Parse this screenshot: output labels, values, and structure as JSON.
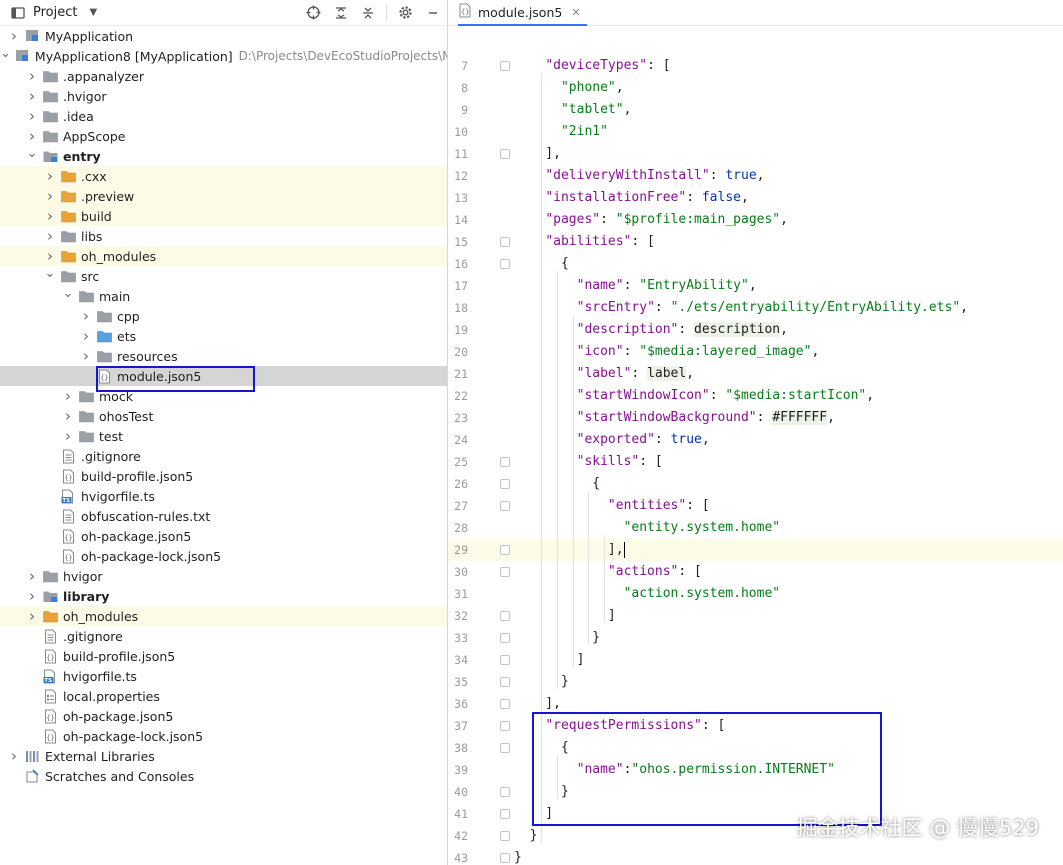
{
  "project_panel": {
    "title": "Project",
    "tree": [
      {
        "label": "MyApplication",
        "icon": "module-icon",
        "chev": "right",
        "indent": 0
      },
      {
        "label": "MyApplication8 [MyApplication]",
        "path": "D:\\Projects\\DevEcoStudioProjects\\M",
        "icon": "module-icon",
        "chev": "down",
        "indent": 0
      },
      {
        "label": ".appanalyzer",
        "icon": "folder-icon",
        "chev": "right",
        "indent": 1
      },
      {
        "label": ".hvigor",
        "icon": "folder-icon",
        "chev": "right",
        "indent": 1
      },
      {
        "label": ".idea",
        "icon": "folder-icon",
        "chev": "right",
        "indent": 1
      },
      {
        "label": "AppScope",
        "icon": "folder-icon",
        "chev": "right",
        "indent": 1
      },
      {
        "label": "entry",
        "icon": "module-folder-icon",
        "chev": "down",
        "indent": 1,
        "bold": true
      },
      {
        "label": ".cxx",
        "icon": "orange-folder-icon",
        "chev": "right",
        "indent": 2,
        "hl": true
      },
      {
        "label": ".preview",
        "icon": "orange-folder-icon",
        "chev": "right",
        "indent": 2,
        "hl": true
      },
      {
        "label": "build",
        "icon": "orange-folder-icon",
        "chev": "right",
        "indent": 2,
        "hl": true
      },
      {
        "label": "libs",
        "icon": "folder-icon",
        "chev": "right",
        "indent": 2
      },
      {
        "label": "oh_modules",
        "icon": "orange-folder-icon",
        "chev": "right",
        "indent": 2,
        "hl": true
      },
      {
        "label": "src",
        "icon": "folder-icon",
        "chev": "down",
        "indent": 2
      },
      {
        "label": "main",
        "icon": "folder-icon",
        "chev": "down",
        "indent": 3
      },
      {
        "label": "cpp",
        "icon": "folder-icon",
        "chev": "right",
        "indent": 4
      },
      {
        "label": "ets",
        "icon": "blue-folder-icon",
        "chev": "right",
        "indent": 4
      },
      {
        "label": "resources",
        "icon": "folder-icon",
        "chev": "right",
        "indent": 4
      },
      {
        "label": "module.json5",
        "icon": "json-file-icon",
        "chev": "none",
        "indent": 4,
        "sel": true
      },
      {
        "label": "mock",
        "icon": "folder-icon",
        "chev": "right",
        "indent": 3
      },
      {
        "label": "ohosTest",
        "icon": "folder-icon",
        "chev": "right",
        "indent": 3
      },
      {
        "label": "test",
        "icon": "folder-icon",
        "chev": "right",
        "indent": 3
      },
      {
        "label": ".gitignore",
        "icon": "text-file-icon",
        "chev": "none",
        "indent": 2
      },
      {
        "label": "build-profile.json5",
        "icon": "json-file-icon",
        "chev": "none",
        "indent": 2
      },
      {
        "label": "hvigorfile.ts",
        "icon": "ts-file-icon",
        "chev": "none",
        "indent": 2
      },
      {
        "label": "obfuscation-rules.txt",
        "icon": "text-file-icon",
        "chev": "none",
        "indent": 2
      },
      {
        "label": "oh-package.json5",
        "icon": "json-file-icon",
        "chev": "none",
        "indent": 2
      },
      {
        "label": "oh-package-lock.json5",
        "icon": "json-file-icon",
        "chev": "none",
        "indent": 2
      },
      {
        "label": "hvigor",
        "icon": "folder-icon",
        "chev": "right",
        "indent": 1
      },
      {
        "label": "library",
        "icon": "module-folder-icon",
        "chev": "right",
        "indent": 1,
        "bold": true
      },
      {
        "label": "oh_modules",
        "icon": "orange-folder-icon",
        "chev": "right",
        "indent": 1,
        "hl": true
      },
      {
        "label": ".gitignore",
        "icon": "text-file-icon",
        "chev": "none",
        "indent": 1
      },
      {
        "label": "build-profile.json5",
        "icon": "json-file-icon",
        "chev": "none",
        "indent": 1
      },
      {
        "label": "hvigorfile.ts",
        "icon": "ts-file-icon",
        "chev": "none",
        "indent": 1
      },
      {
        "label": "local.properties",
        "icon": "properties-file-icon",
        "chev": "none",
        "indent": 1
      },
      {
        "label": "oh-package.json5",
        "icon": "json-file-icon",
        "chev": "none",
        "indent": 1
      },
      {
        "label": "oh-package-lock.json5",
        "icon": "json-file-icon",
        "chev": "none",
        "indent": 1
      },
      {
        "label": "External Libraries",
        "icon": "libraries-icon",
        "chev": "right",
        "indent": 0
      },
      {
        "label": "Scratches and Consoles",
        "icon": "scratches-icon",
        "chev": "none",
        "indent": 0
      }
    ]
  },
  "editor": {
    "tab_label": "module.json5",
    "current_line": "29",
    "lines": [
      {
        "n": "7",
        "t": [
          [
            "    ",
            "p"
          ],
          [
            "\"deviceTypes\"",
            "k"
          ],
          [
            ": [",
            "p"
          ]
        ]
      },
      {
        "n": "8",
        "t": [
          [
            "      ",
            "p"
          ],
          [
            "\"phone\"",
            "s"
          ],
          [
            ",",
            "p"
          ]
        ]
      },
      {
        "n": "9",
        "t": [
          [
            "      ",
            "p"
          ],
          [
            "\"tablet\"",
            "s"
          ],
          [
            ",",
            "p"
          ]
        ]
      },
      {
        "n": "10",
        "t": [
          [
            "      ",
            "p"
          ],
          [
            "\"2in1\"",
            "s"
          ]
        ]
      },
      {
        "n": "11",
        "t": [
          [
            "    ],",
            "p"
          ]
        ]
      },
      {
        "n": "12",
        "t": [
          [
            "    ",
            "p"
          ],
          [
            "\"deliveryWithInstall\"",
            "k"
          ],
          [
            ": ",
            "p"
          ],
          [
            "true",
            "b"
          ],
          [
            ",",
            "p"
          ]
        ]
      },
      {
        "n": "13",
        "t": [
          [
            "    ",
            "p"
          ],
          [
            "\"installationFree\"",
            "k"
          ],
          [
            ": ",
            "p"
          ],
          [
            "false",
            "b"
          ],
          [
            ",",
            "p"
          ]
        ]
      },
      {
        "n": "14",
        "t": [
          [
            "    ",
            "p"
          ],
          [
            "\"pages\"",
            "k"
          ],
          [
            ": ",
            "p"
          ],
          [
            "\"$profile:main_pages\"",
            "s"
          ],
          [
            ",",
            "p"
          ]
        ]
      },
      {
        "n": "15",
        "t": [
          [
            "    ",
            "p"
          ],
          [
            "\"abilities\"",
            "k"
          ],
          [
            ": [",
            "p"
          ]
        ]
      },
      {
        "n": "16",
        "t": [
          [
            "      {",
            "p"
          ]
        ]
      },
      {
        "n": "17",
        "t": [
          [
            "        ",
            "p"
          ],
          [
            "\"name\"",
            "k"
          ],
          [
            ": ",
            "p"
          ],
          [
            "\"EntryAbility\"",
            "s"
          ],
          [
            ",",
            "p"
          ]
        ]
      },
      {
        "n": "18",
        "t": [
          [
            "        ",
            "p"
          ],
          [
            "\"srcEntry\"",
            "k"
          ],
          [
            ": ",
            "p"
          ],
          [
            "\"./ets/entryability/EntryAbility.ets\"",
            "s"
          ],
          [
            ",",
            "p"
          ]
        ]
      },
      {
        "n": "19",
        "t": [
          [
            "        ",
            "p"
          ],
          [
            "\"description\"",
            "k"
          ],
          [
            ": ",
            "p"
          ],
          [
            "description",
            "r"
          ],
          [
            ",",
            "p"
          ]
        ]
      },
      {
        "n": "20",
        "t": [
          [
            "        ",
            "p"
          ],
          [
            "\"icon\"",
            "k"
          ],
          [
            ": ",
            "p"
          ],
          [
            "\"$media:layered_image\"",
            "s"
          ],
          [
            ",",
            "p"
          ]
        ]
      },
      {
        "n": "21",
        "t": [
          [
            "        ",
            "p"
          ],
          [
            "\"label\"",
            "k"
          ],
          [
            ": ",
            "p"
          ],
          [
            "label",
            "r"
          ],
          [
            ",",
            "p"
          ]
        ]
      },
      {
        "n": "22",
        "t": [
          [
            "        ",
            "p"
          ],
          [
            "\"startWindowIcon\"",
            "k"
          ],
          [
            ": ",
            "p"
          ],
          [
            "\"$media:startIcon\"",
            "s"
          ],
          [
            ",",
            "p"
          ]
        ]
      },
      {
        "n": "23",
        "t": [
          [
            "        ",
            "p"
          ],
          [
            "\"startWindowBackground\"",
            "k"
          ],
          [
            ": ",
            "p"
          ],
          [
            "#FFFFFF",
            "r"
          ],
          [
            ",",
            "p"
          ]
        ]
      },
      {
        "n": "24",
        "t": [
          [
            "        ",
            "p"
          ],
          [
            "\"exported\"",
            "k"
          ],
          [
            ": ",
            "p"
          ],
          [
            "true",
            "b"
          ],
          [
            ",",
            "p"
          ]
        ]
      },
      {
        "n": "25",
        "t": [
          [
            "        ",
            "p"
          ],
          [
            "\"skills\"",
            "k"
          ],
          [
            ": [",
            "p"
          ]
        ]
      },
      {
        "n": "26",
        "t": [
          [
            "          {",
            "p"
          ]
        ]
      },
      {
        "n": "27",
        "t": [
          [
            "            ",
            "p"
          ],
          [
            "\"entities\"",
            "k"
          ],
          [
            ": [",
            "p"
          ]
        ]
      },
      {
        "n": "28",
        "t": [
          [
            "              ",
            "p"
          ],
          [
            "\"entity.system.home\"",
            "s"
          ]
        ]
      },
      {
        "n": "29",
        "t": [
          [
            "            ],",
            "p"
          ]
        ],
        "caret": true
      },
      {
        "n": "30",
        "t": [
          [
            "            ",
            "p"
          ],
          [
            "\"actions\"",
            "k"
          ],
          [
            ": [",
            "p"
          ]
        ]
      },
      {
        "n": "31",
        "t": [
          [
            "              ",
            "p"
          ],
          [
            "\"action.system.home\"",
            "s"
          ]
        ]
      },
      {
        "n": "32",
        "t": [
          [
            "            ]",
            "p"
          ]
        ]
      },
      {
        "n": "33",
        "t": [
          [
            "          }",
            "p"
          ]
        ]
      },
      {
        "n": "34",
        "t": [
          [
            "        ]",
            "p"
          ]
        ]
      },
      {
        "n": "35",
        "t": [
          [
            "      }",
            "p"
          ]
        ]
      },
      {
        "n": "36",
        "t": [
          [
            "    ],",
            "p"
          ]
        ]
      },
      {
        "n": "37",
        "t": [
          [
            "    ",
            "p"
          ],
          [
            "\"requestPermissions\"",
            "k"
          ],
          [
            ": [",
            "p"
          ]
        ]
      },
      {
        "n": "38",
        "t": [
          [
            "      {",
            "p"
          ]
        ]
      },
      {
        "n": "39",
        "t": [
          [
            "        ",
            "p"
          ],
          [
            "\"name\"",
            "k"
          ],
          [
            ":",
            "p"
          ],
          [
            "\"ohos.permission.INTERNET\"",
            "s"
          ]
        ]
      },
      {
        "n": "40",
        "t": [
          [
            "      }",
            "p"
          ]
        ]
      },
      {
        "n": "41",
        "t": [
          [
            "    ]",
            "p"
          ]
        ]
      },
      {
        "n": "42",
        "t": [
          [
            "  }",
            "p"
          ]
        ]
      },
      {
        "n": "43",
        "t": [
          [
            "}",
            "p"
          ]
        ]
      }
    ]
  },
  "watermark": "掘金技术社区 @ 慢慢529",
  "colors": {
    "selection_box": "#1515d4",
    "keyword": "#871094",
    "string": "#067d17",
    "boolean": "#0033b3"
  }
}
